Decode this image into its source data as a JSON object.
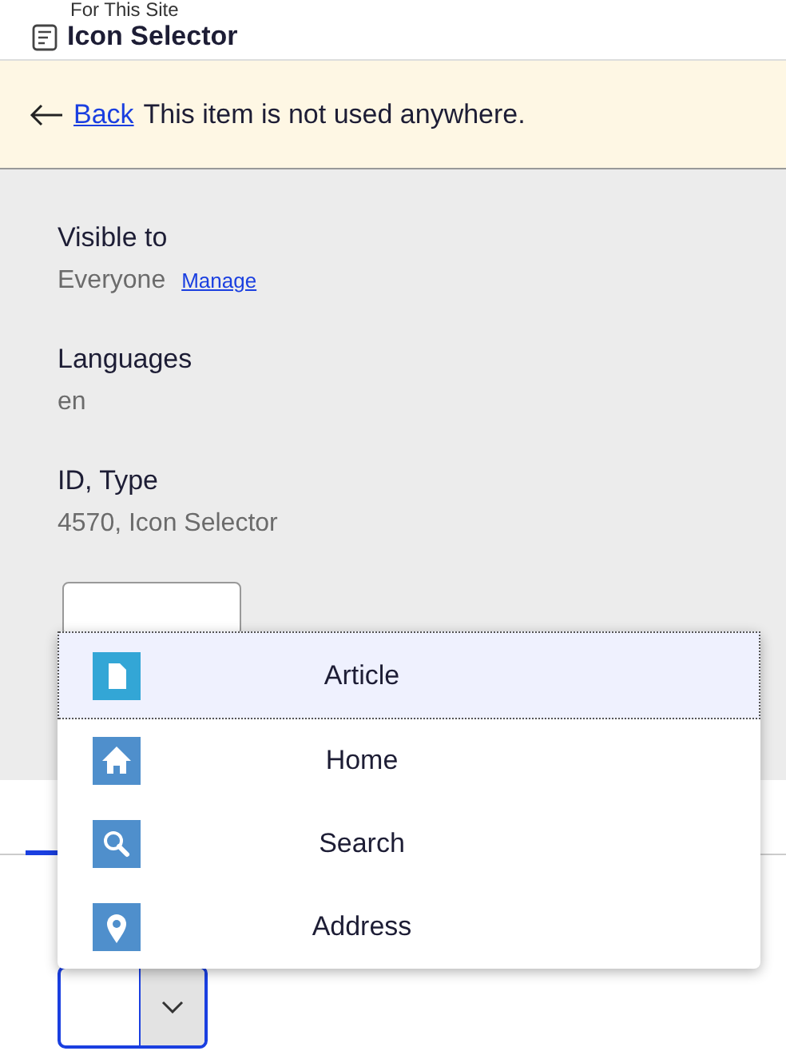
{
  "breadcrumb": "For This Site",
  "title": "Icon Selector",
  "notice": {
    "link": "Back",
    "message": "This item is not used anywhere."
  },
  "properties": [
    {
      "label": "Visible to",
      "value": "Everyone",
      "action": "Manage"
    },
    {
      "label": "Languages",
      "value": "en"
    },
    {
      "label": "ID, Type",
      "value": "4570, Icon Selector"
    }
  ],
  "dropdown": {
    "options": [
      {
        "label": "Article",
        "selected": true
      },
      {
        "label": "Home",
        "selected": false
      },
      {
        "label": "Search",
        "selected": false
      },
      {
        "label": "Address",
        "selected": false
      }
    ]
  }
}
